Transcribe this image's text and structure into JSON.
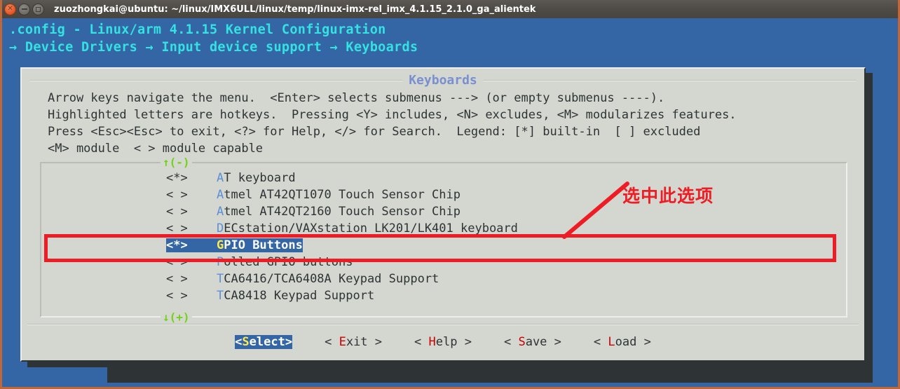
{
  "window": {
    "title": "zuozhongkai@ubuntu: ~/linux/IMX6ULL/linux/temp/linux-imx-rel_imx_4.1.15_2.1.0_ga_alientek",
    "controls": {
      "close": "close-button",
      "minimize": "minimize-button",
      "maximize": "maximize-button"
    }
  },
  "menuconfig": {
    "header_line1": ".config - Linux/arm 4.1.15 Kernel Configuration",
    "header_line2": "→ Device Drivers → Input device support → Keyboards",
    "dialog_title": "Keyboards",
    "help_text": "Arrow keys navigate the menu.  <Enter> selects submenus ---> (or empty submenus ----).\nHighlighted letters are hotkeys.  Pressing <Y> includes, <N> excludes, <M> modularizes features.\nPress <Esc><Esc> to exit, <?> for Help, </> for Search.  Legend: [*] built-in  [ ] excluded\n<M> module  < > module capable",
    "scroll_up": "↑(-)",
    "scroll_down": "↓(+)",
    "rows": [
      {
        "flag": "<*>",
        "hotkey": "A",
        "rest": "T keyboard",
        "selected": false
      },
      {
        "flag": "< >",
        "hotkey": "A",
        "rest": "tmel AT42QT1070 Touch Sensor Chip",
        "selected": false
      },
      {
        "flag": "< >",
        "hotkey": "A",
        "rest": "tmel AT42QT2160 Touch Sensor Chip",
        "selected": false
      },
      {
        "flag": "< >",
        "hotkey": "D",
        "rest": "ECstation/VAXstation LK201/LK401 keyboard",
        "selected": false
      },
      {
        "flag": "<*>",
        "hotkey": "G",
        "rest": "PIO Buttons",
        "selected": true
      },
      {
        "flag": "< >",
        "hotkey": "P",
        "rest": "olled GPIO buttons",
        "selected": false
      },
      {
        "flag": "< >",
        "hotkey": "T",
        "rest": "CA6416/TCA6408A Keypad Support",
        "selected": false
      },
      {
        "flag": "< >",
        "hotkey": "T",
        "rest": "CA8418 Keypad Support",
        "selected": false
      }
    ],
    "buttons": [
      {
        "open": "<",
        "hotkey": "S",
        "rest": "elect",
        "close": ">",
        "active": true
      },
      {
        "open": "< ",
        "hotkey": "E",
        "rest": "xit",
        "close": " >",
        "active": false
      },
      {
        "open": "< ",
        "hotkey": "H",
        "rest": "elp",
        "close": " >",
        "active": false
      },
      {
        "open": "< ",
        "hotkey": "S",
        "rest": "ave",
        "close": " >",
        "active": false
      },
      {
        "open": "< ",
        "hotkey": "L",
        "rest": "oad",
        "close": " >",
        "active": false
      }
    ]
  },
  "annotation": {
    "text": "选中此选项",
    "color": "#ee1c25"
  },
  "colors": {
    "terminal_background": "#3465a4",
    "dialog_background": "#d3d7cf",
    "header_text": "#34e2e2",
    "dialog_title": "#7a8fd0",
    "highlight_background": "#3465a4",
    "hotkey_blue": "#5c8fd6",
    "hotkey_yellow": "#fce94f",
    "hotkey_red": "#cc0000",
    "scroll_green": "#73d216",
    "window_border": "#c0673a"
  }
}
